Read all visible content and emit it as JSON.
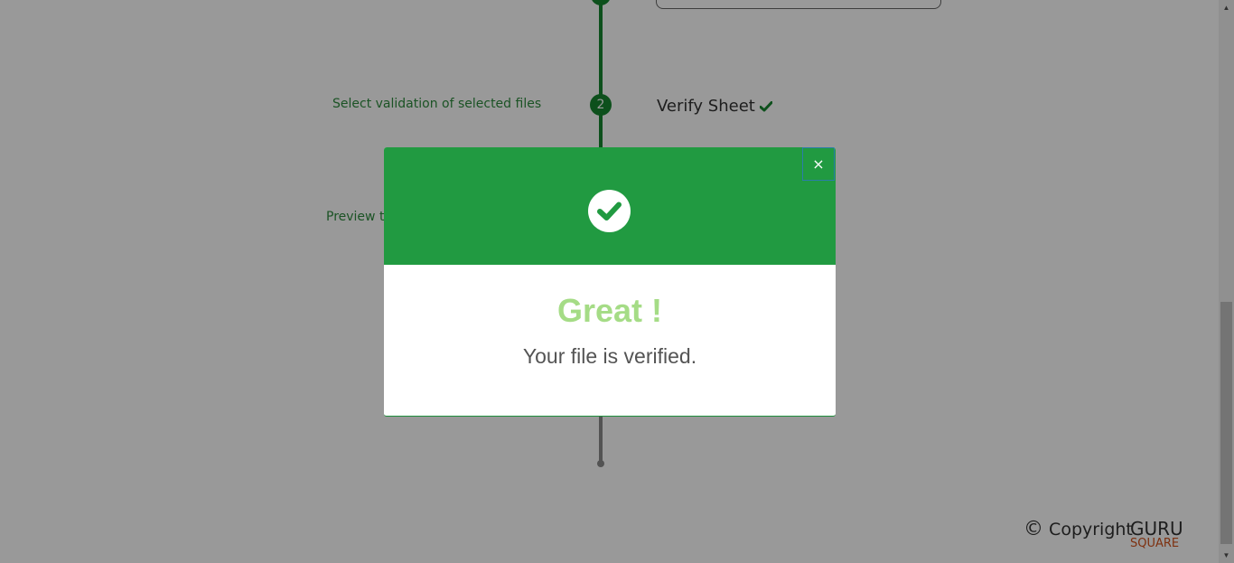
{
  "timeline": {
    "step2": {
      "number": "2",
      "description": "Select validation of selected files",
      "title": "Verify Sheet",
      "status_icon": "check-icon"
    },
    "step3": {
      "description": "Preview t"
    }
  },
  "footer": {
    "copyright_symbol": "©",
    "copyright_label": "Copyright",
    "logo_text_top": "GURU",
    "logo_text_bottom": "SQUARE"
  },
  "modal": {
    "icon": "check-circle-icon",
    "close_label": "×",
    "title": "Great !",
    "message": "Your file is verified."
  },
  "colors": {
    "primary_green": "#219a41",
    "title_green": "#a5dc86",
    "logo_orange": "#d2521c"
  }
}
